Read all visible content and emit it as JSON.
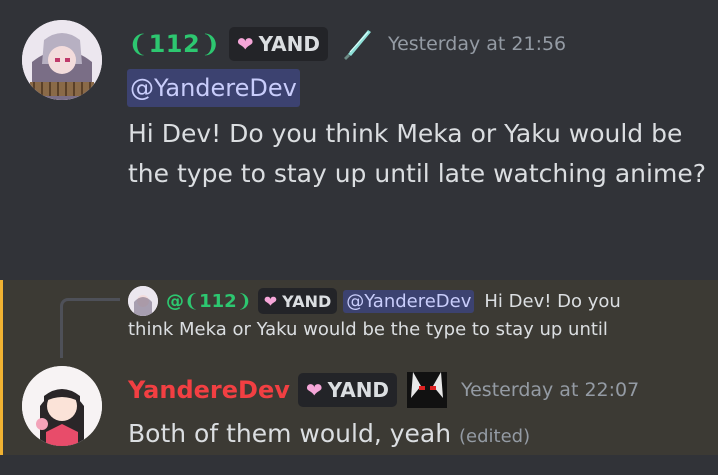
{
  "message1": {
    "author": "❨112❩",
    "role_tag": "YAND",
    "timestamp": "Yesterday at 21:56",
    "mention": "@YandereDev",
    "text": "Hi Dev! Do you think Meka or Yaku would be the type to stay up until late watching anime?"
  },
  "message2": {
    "reply": {
      "author": "@❨112❩",
      "role_tag": "YAND",
      "mention": "@YandereDev",
      "text_line1": "Hi Dev! Do you",
      "text_line2": "think Meka or Yaku would be the type to stay up until"
    },
    "author": "YandereDev",
    "role_tag": "YAND",
    "timestamp": "Yesterday at 22:07",
    "text": "Both of them would, yeah",
    "edited_label": "(edited)"
  },
  "colors": {
    "background": "#313338",
    "highlight_background": "#3c3a34",
    "highlight_border": "#f0b232",
    "green_name": "#2dc770",
    "red_name": "#f23f42",
    "mention_bg": "#3c4270"
  },
  "icons": [
    "avatar-anime-girl",
    "heart-icon",
    "knife-icon",
    "anime-emote"
  ]
}
